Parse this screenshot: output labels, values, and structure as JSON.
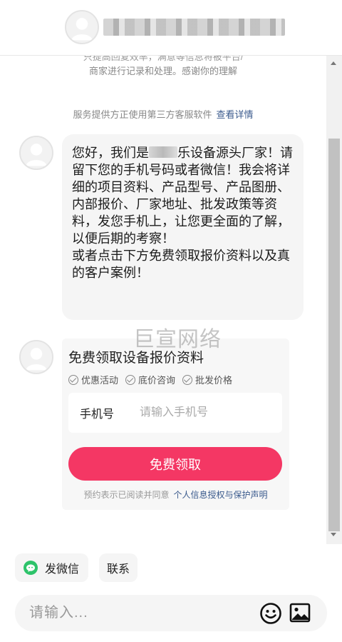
{
  "header": {
    "title": "████████████████8"
  },
  "chat": {
    "notice_line1": "只提高回复效率，满意等信息将被平台/",
    "notice_line2": "商家进行记录和处理。感谢你的理解",
    "service_note": "服务提供方正使用第三方客服软件",
    "service_link": "查看详情",
    "welcome_message": {
      "part1": "您好，我们是",
      "part2": "乐设备源头厂家！请留下您的手机号码或者微信！我会将详细的项目资料、产品型号、产品图册、内部报价、厂家地址、批发政策等资料，发您手机上，让您更全面的了解，以便后期的考察！",
      "part3": "或者点击下方免费领取报价资料以及真的客户案例！"
    },
    "watermark": "巨宣网络"
  },
  "form": {
    "title": "免费领取设备报价资料",
    "tags": [
      "优惠活动",
      "底价咨询",
      "批发价格"
    ],
    "phone_label": "手机号",
    "phone_placeholder": "请输入手机号",
    "submit_label": "免费领取",
    "agree_text": "预约表示已阅读并同意",
    "agree_link": "个人信息授权与保护声明"
  },
  "quick_actions": {
    "wechat": "发微信",
    "contact": "联系"
  },
  "composer": {
    "placeholder": "请输入..."
  },
  "colors": {
    "primary_button": "#f43764",
    "link": "#3a5a8c",
    "wechat_green": "#2dc36a"
  }
}
